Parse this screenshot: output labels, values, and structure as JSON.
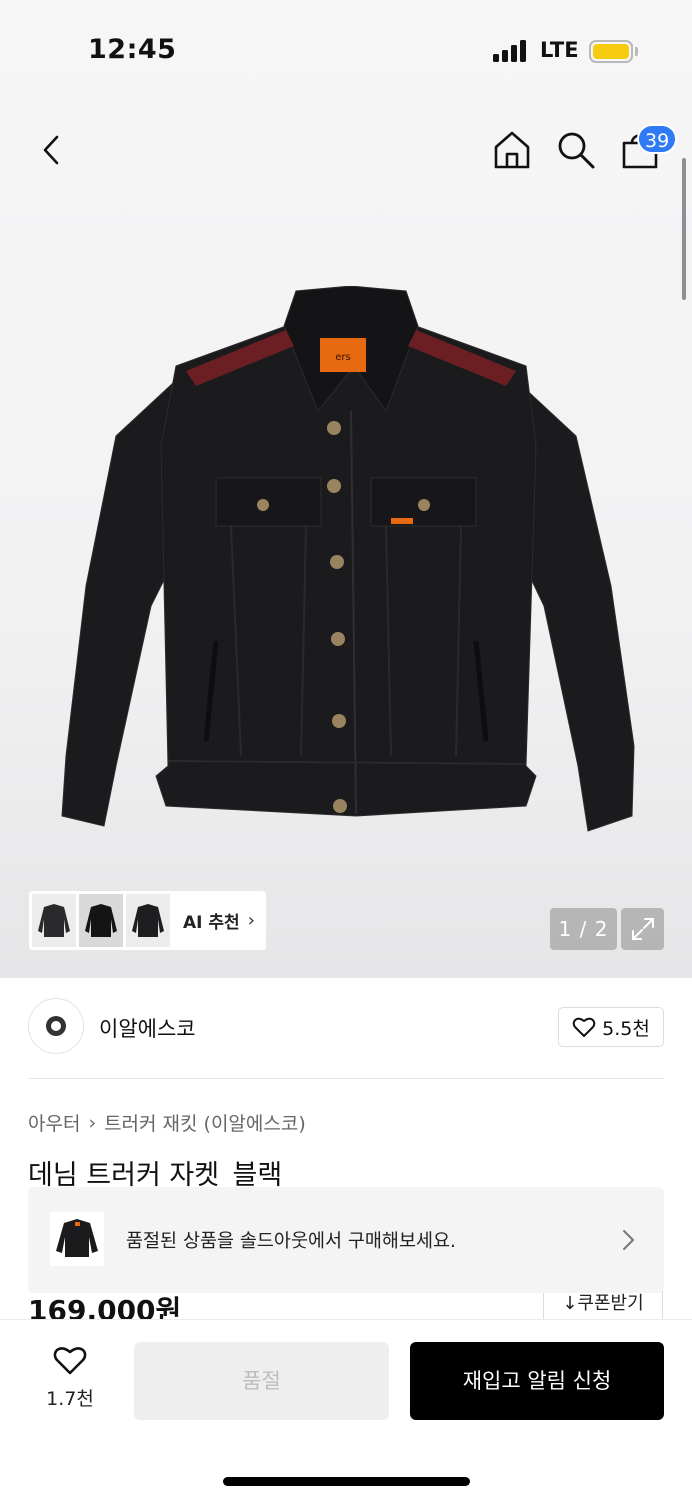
{
  "status_bar": {
    "time": "12:45",
    "network": "LTE",
    "battery_color": "#f7cc10"
  },
  "nav": {
    "cart_count": "39",
    "icons": [
      "back-arrow-icon",
      "home-icon",
      "search-icon",
      "shopping-bag-icon"
    ]
  },
  "gallery": {
    "page_indicator": "1 / 2",
    "ai_label": "AI 추천",
    "ai_chevron": "›",
    "thumbnail_count": 3
  },
  "brand": {
    "name": "이알에스코",
    "likes": "5.5천"
  },
  "breadcrumb": {
    "category": "아우터",
    "separator": "›",
    "subcategory": "트러커 재킷 (이알에스코)"
  },
  "product": {
    "title": "데님 트러커 자켓_블랙",
    "price": "169,000원"
  },
  "soldout_banner": {
    "text": "품절된 상품을 솔드아웃에서 구매해보세요."
  },
  "coupon": {
    "label": "↓쿠폰받기"
  },
  "bottom_bar": {
    "wish_count": "1.7천",
    "soldout_label": "품절",
    "restock_label": "재입고 알림 신청"
  },
  "colors": {
    "accent_badge": "#2f7bf5",
    "primary_button": "#000000",
    "disabled_button": "#eeeeee"
  }
}
